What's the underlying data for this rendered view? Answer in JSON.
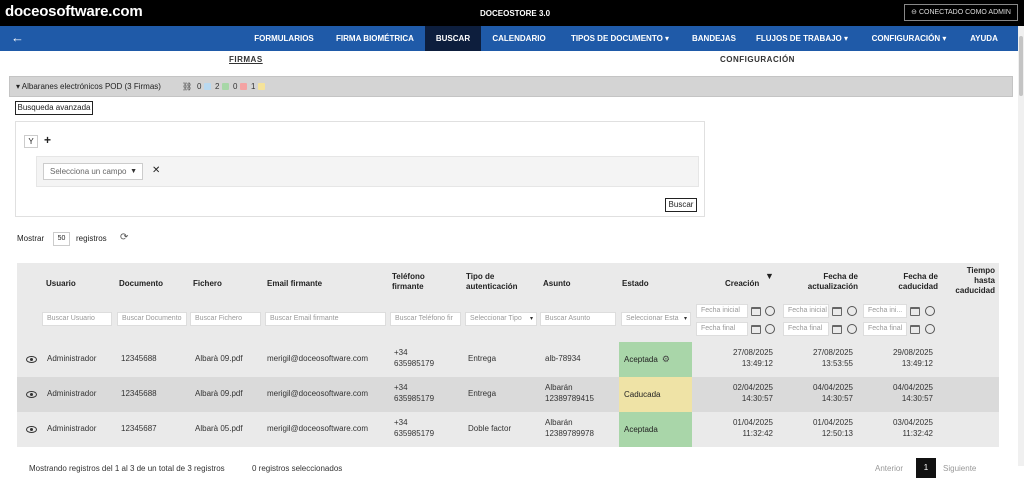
{
  "topbar": {
    "logo": "doceosoftware.com",
    "app_name": "DOCEOSTORE 3.0",
    "connected": "CONECTADO COMO ADMIN"
  },
  "nav": {
    "back_icon": "arrow-left-icon",
    "items": [
      {
        "label": "FORMULARIOS"
      },
      {
        "label": "FIRMA BIOMÉTRICA"
      },
      {
        "label": "BUSCAR"
      },
      {
        "label": "CALENDARIO"
      },
      {
        "label": "TIPOS DE DOCUMENTO ▾"
      },
      {
        "label": "BANDEJAS"
      },
      {
        "label": "FLUJOS DE TRABAJO ▾"
      },
      {
        "label": "CONFIGURACIÓN ▾"
      },
      {
        "label": "AYUDA"
      }
    ],
    "active_index": 2,
    "accent": "#1f5aa8"
  },
  "subtabs": [
    "FIRMAS",
    "CONFIGURACIÓN"
  ],
  "panel": {
    "title": "▾ Albaranes electrónicos POD (3 Firmas)",
    "counts": [
      "0",
      "2",
      "0",
      "1"
    ],
    "count_colors": [
      "#b9d9f0",
      "#a7d7a7",
      "#f4a3a3",
      "#f5e39a"
    ]
  },
  "filters": {
    "advanced_button": "Busqueda avanzada",
    "logic": "Y",
    "add": "+",
    "field_placeholder": "Selecciona un campo",
    "remove": "✕",
    "search_button": "Buscar"
  },
  "paging": {
    "show": "Mostrar",
    "page_size": "50",
    "records": "registros",
    "info": "Mostrando registros del 1 al 3 de un total de 3 registros",
    "selected": "0 registros seleccionados",
    "prev": "Anterior",
    "page": "1",
    "next": "Siguiente"
  },
  "table": {
    "headers": {
      "usuario": "Usuario",
      "documento": "Documento",
      "fichero": "Fichero",
      "email": "Email firmante",
      "telefono": "Teléfono firmante",
      "tipo": "Tipo de autenticación",
      "asunto": "Asunto",
      "estado": "Estado",
      "creacion": "Creación",
      "sort": "▼",
      "actualizacion": "Fecha de actualización",
      "caducidad": "Fecha de caducidad",
      "tiempo": "Tiempo hasta caducidad"
    },
    "filter_placeholders": {
      "usuario": "Buscar Usuario",
      "documento": "Buscar Documento",
      "fichero": "Buscar Fichero",
      "email": "Buscar Email firmante",
      "telefono": "Buscar Teléfono fir",
      "tipo": "Seleccionar Tipo",
      "asunto": "Buscar Asunto",
      "estado": "Seleccionar Esta",
      "fecha_inicial": "Fecha inicial",
      "fecha_final": "Fecha final",
      "fecha_ini_short": "Fecha ini..."
    },
    "rows": [
      {
        "usuario": "Administrador",
        "documento": "12345688",
        "fichero": "Albarà 09.pdf",
        "email": "merigil@doceosoftware.com",
        "tel1": "+34",
        "tel2": "635985179",
        "tipo": "Entrega",
        "asunto1": "alb-78934",
        "asunto2": "",
        "estado": "Aceptada",
        "estado_color": "#a9d6a9",
        "creacion1": "27/08/2025",
        "creacion2": "13:49:12",
        "act1": "27/08/2025",
        "act2": "13:53:55",
        "cad1": "29/08/2025",
        "cad2": "13:49:12",
        "bg": "#eaeaea"
      },
      {
        "usuario": "Administrador",
        "documento": "12345688",
        "fichero": "Albarà 09.pdf",
        "email": "merigil@doceosoftware.com",
        "tel1": "+34",
        "tel2": "635985179",
        "tipo": "Entrega",
        "asunto1": "Albarán",
        "asunto2": "12389789415",
        "estado": "Caducada",
        "estado_color": "#efe3a6",
        "creacion1": "02/04/2025",
        "creacion2": "14:30:57",
        "act1": "04/04/2025",
        "act2": "14:30:57",
        "cad1": "04/04/2025",
        "cad2": "14:30:57",
        "bg": "#dadada"
      },
      {
        "usuario": "Administrador",
        "documento": "12345687",
        "fichero": "Albarà 05.pdf",
        "email": "merigil@doceosoftware.com",
        "tel1": "+34",
        "tel2": "635985179",
        "tipo": "Doble factor",
        "asunto1": "Albarán",
        "asunto2": "12389789978",
        "estado": "Aceptada",
        "estado_color": "#a9d6a9",
        "creacion1": "01/04/2025",
        "creacion2": "11:32:42",
        "act1": "01/04/2025",
        "act2": "12:50:13",
        "cad1": "03/04/2025",
        "cad2": "11:32:42",
        "bg": "#eaeaea"
      }
    ]
  }
}
